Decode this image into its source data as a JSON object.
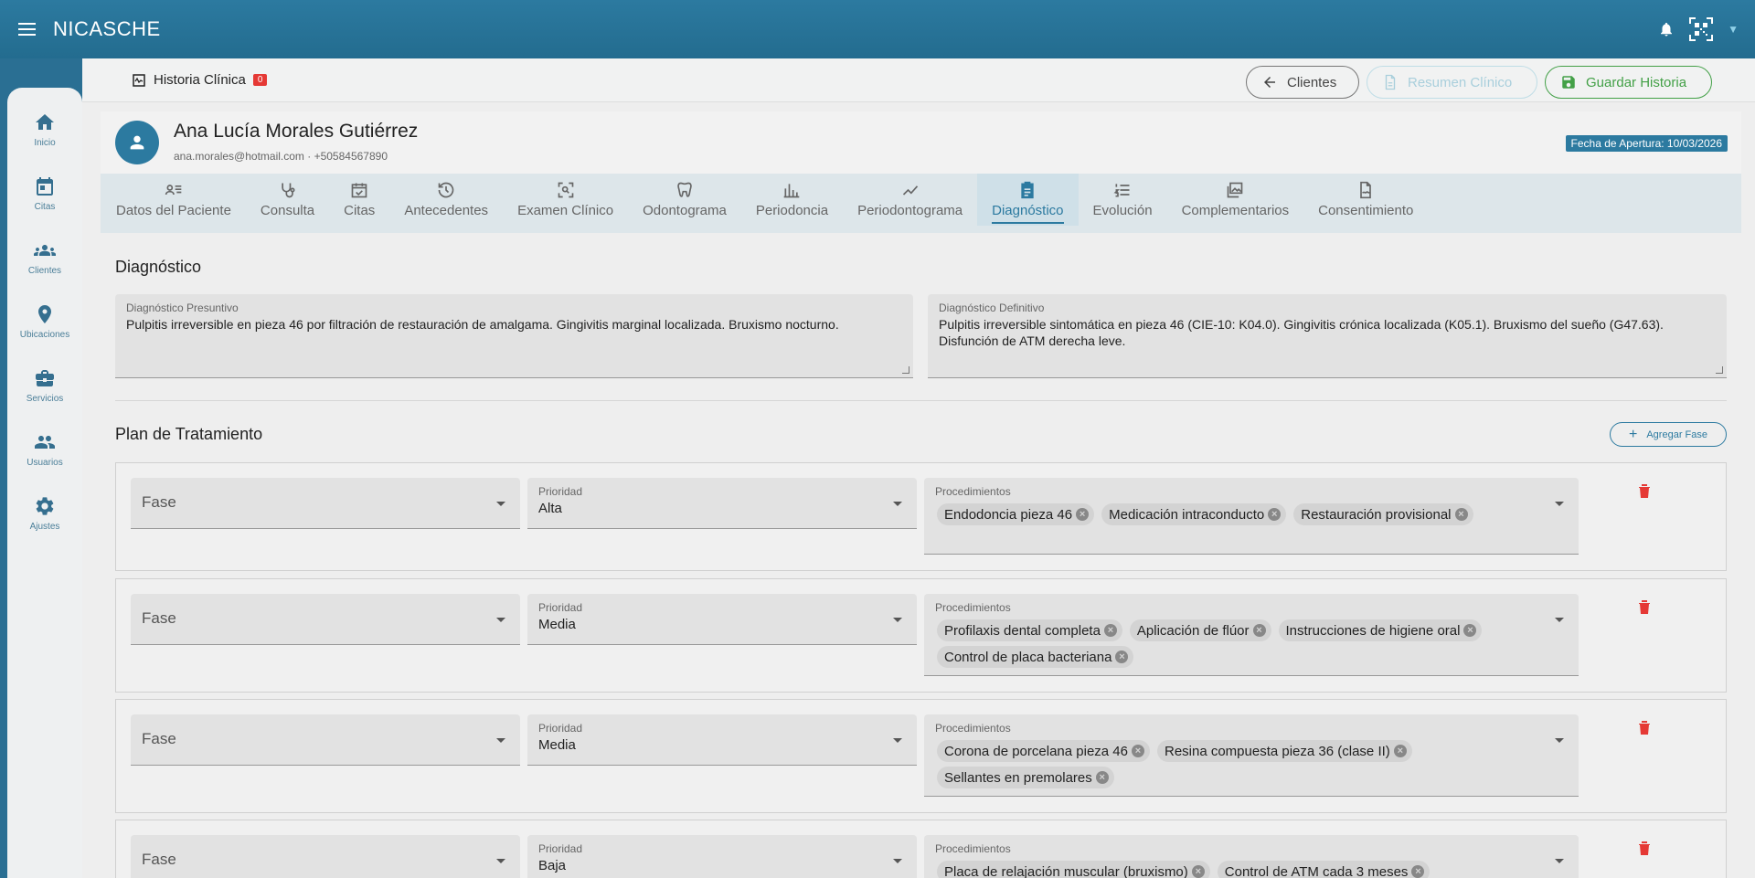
{
  "app": {
    "brand": "NICASCHE"
  },
  "sidebar": {
    "items": [
      {
        "label": "Inicio",
        "icon": "home-icon"
      },
      {
        "label": "Citas",
        "icon": "calendar-icon"
      },
      {
        "label": "Clientes",
        "icon": "group-icon"
      },
      {
        "label": "Ubicaciones",
        "icon": "location-pin-icon"
      },
      {
        "label": "Servicios",
        "icon": "briefcase-icon"
      },
      {
        "label": "Usuarios",
        "icon": "users-icon"
      },
      {
        "label": "Ajustes",
        "icon": "gear-icon"
      }
    ]
  },
  "header": {
    "title": "Historia Clínica",
    "badge": "0",
    "btn_clientes": "Clientes",
    "btn_resumen": "Resumen Clínico",
    "btn_guardar": "Guardar Historia"
  },
  "patient": {
    "name": "Ana Lucía Morales Gutiérrez",
    "contact": "ana.morales@hotmail.com · +50584567890",
    "opening_date": "Fecha de Apertura: 10/03/2026"
  },
  "tabs": [
    {
      "label": "Datos del Paciente"
    },
    {
      "label": "Consulta"
    },
    {
      "label": "Citas"
    },
    {
      "label": "Antecedentes"
    },
    {
      "label": "Examen Clínico"
    },
    {
      "label": "Odontograma"
    },
    {
      "label": "Periodoncia"
    },
    {
      "label": "Periodontograma"
    },
    {
      "label": "Diagnóstico"
    },
    {
      "label": "Evolución"
    },
    {
      "label": "Complementarios"
    },
    {
      "label": "Consentimiento"
    }
  ],
  "diagnostico": {
    "title": "Diagnóstico",
    "presuntivo_label": "Diagnóstico Presuntivo",
    "presuntivo_value": "Pulpitis irreversible en pieza 46 por filtración de restauración de amalgama. Gingivitis marginal localizada. Bruxismo nocturno.",
    "definitivo_label": "Diagnóstico Definitivo",
    "definitivo_value": "Pulpitis irreversible sintomática en pieza 46 (CIE-10: K04.0). Gingivitis crónica localizada (K05.1). Bruxismo del sueño (G47.63). Disfunción de ATM derecha leve."
  },
  "plan": {
    "title": "Plan de Tratamiento",
    "add_label": "Agregar Fase",
    "fase_placeholder": "Fase",
    "prioridad_label": "Prioridad",
    "procedimientos_label": "Procedimientos",
    "phases": [
      {
        "prioridad": "Alta",
        "procedimientos": [
          "Endodoncia pieza 46",
          "Medicación intraconducto",
          "Restauración provisional"
        ]
      },
      {
        "prioridad": "Media",
        "procedimientos": [
          "Profilaxis dental completa",
          "Aplicación de flúor",
          "Instrucciones de higiene oral",
          "Control de placa bacteriana"
        ]
      },
      {
        "prioridad": "Media",
        "procedimientos": [
          "Corona de porcelana pieza 46",
          "Resina compuesta pieza 36 (clase II)",
          "Sellantes en premolares"
        ]
      },
      {
        "prioridad": "Baja",
        "procedimientos": [
          "Placa de relajación muscular (bruxismo)",
          "Control de ATM cada 3 meses"
        ]
      }
    ]
  },
  "colors": {
    "primary": "#2c7aa0",
    "danger": "#e53935",
    "success": "#43a047"
  }
}
